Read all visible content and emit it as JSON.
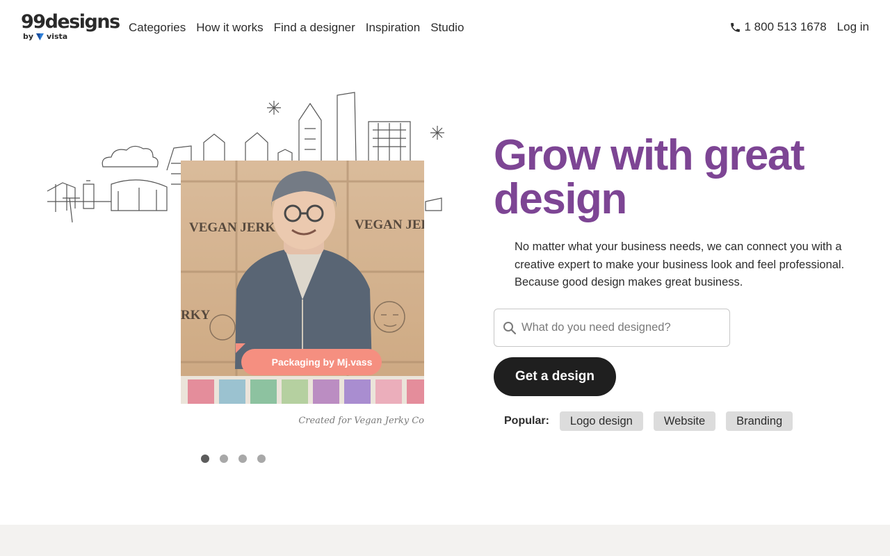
{
  "header": {
    "logo_text": "99designs",
    "logo_by": "by",
    "logo_brand": "vista",
    "nav": [
      {
        "label": "Categories"
      },
      {
        "label": "How it works"
      },
      {
        "label": "Find a designer"
      },
      {
        "label": "Inspiration"
      },
      {
        "label": "Studio"
      }
    ],
    "phone": "1 800 513 1678",
    "login": "Log in"
  },
  "hero": {
    "headline": "Grow with great design",
    "lead": "No matter what your business needs, we can connect you with a creative expert to make your business look and feel professional. Because good design makes great business.",
    "search_placeholder": "What do you need designed?",
    "cta": "Get a design",
    "popular_label": "Popular:",
    "popular_chips": [
      "Logo design",
      "Website",
      "Branding"
    ],
    "showcase": {
      "caption": "Packaging by Mj.vass",
      "created_for": "Created for Vegan Jerky Co",
      "box_label": "VEGAN JERKY",
      "box_label_partial": "RKY",
      "slides_total": 4,
      "active_slide": 1
    }
  },
  "colors": {
    "headline": "#7d4594",
    "cta_bg": "#1f1f1f",
    "caption_bg": "#f58f80",
    "chip_bg": "#dcdcdc",
    "footer_band": "#f3f2f0"
  }
}
